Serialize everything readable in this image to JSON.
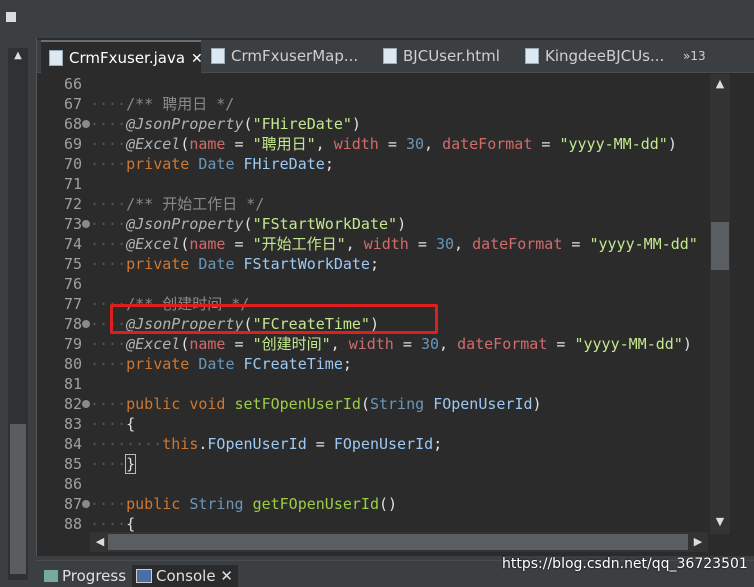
{
  "tabs": [
    {
      "label": "CrmFxuser.java",
      "close": "✕",
      "active": true
    },
    {
      "label": "CrmFxuserMap..."
    },
    {
      "label": "BJCUser.html"
    },
    {
      "label": "KingdeeBJCUs..."
    },
    {
      "label": "»13"
    }
  ],
  "lines": [
    {
      "num": "66"
    },
    {
      "num": "67",
      "comment": "/** 聘用日 */"
    },
    {
      "num": "68",
      "annotation": "@JsonProperty",
      "arg": "\"FHireDate\""
    },
    {
      "num": "69",
      "annotation": "@Excel",
      "p1": "name",
      "v1": "\"聘用日\"",
      "p2": "width",
      "v2": "30",
      "p3": "dateFormat",
      "v3": "\"yyyy-MM-dd\""
    },
    {
      "num": "70",
      "kw": "private",
      "type": "Date",
      "field": "FHireDate"
    },
    {
      "num": "71"
    },
    {
      "num": "72",
      "comment": "/** 开始工作日 */"
    },
    {
      "num": "73",
      "annotation": "@JsonProperty",
      "arg": "\"FStartWorkDate\""
    },
    {
      "num": "74",
      "annotation": "@Excel",
      "p1": "name",
      "v1": "\"开始工作日\"",
      "p2": "width",
      "v2": "30",
      "p3": "dateFormat",
      "v3": "\"yyyy-MM-dd\""
    },
    {
      "num": "75",
      "kw": "private",
      "type": "Date",
      "field": "FStartWorkDate"
    },
    {
      "num": "76"
    },
    {
      "num": "77",
      "comment": "/** 创建时间 */"
    },
    {
      "num": "78",
      "annotation": "@JsonProperty",
      "arg": "\"FCreateTime\""
    },
    {
      "num": "79",
      "annotation": "@Excel",
      "p1": "name",
      "v1": "\"创建时间\"",
      "p2": "width",
      "v2": "30",
      "p3": "dateFormat",
      "v3": "\"yyyy-MM-dd\""
    },
    {
      "num": "80",
      "kw": "private",
      "type": "Date",
      "field": "FCreateTime"
    },
    {
      "num": "81"
    },
    {
      "num": "82",
      "kw": "public",
      "kw2": "void",
      "method": "setFOpenUserId",
      "ptype": "String",
      "pname": "FOpenUserId"
    },
    {
      "num": "83",
      "brace": "{"
    },
    {
      "num": "84",
      "this": "this",
      "field": "FOpenUserId",
      "value": "FOpenUserId"
    },
    {
      "num": "85",
      "brace": "}"
    },
    {
      "num": "86"
    },
    {
      "num": "87",
      "kw": "public",
      "type": "String",
      "method": "getFOpenUserId"
    },
    {
      "num": "88",
      "brace": "{"
    }
  ],
  "bottom_tabs": [
    {
      "label": "Progress"
    },
    {
      "label": "Console",
      "close": "✕",
      "active": true
    }
  ],
  "watermark": "https://blog.csdn.net/qq_36723501",
  "colors": {
    "highlight_box": "#e01e1e",
    "editor_bg": "#2b2b2b"
  }
}
